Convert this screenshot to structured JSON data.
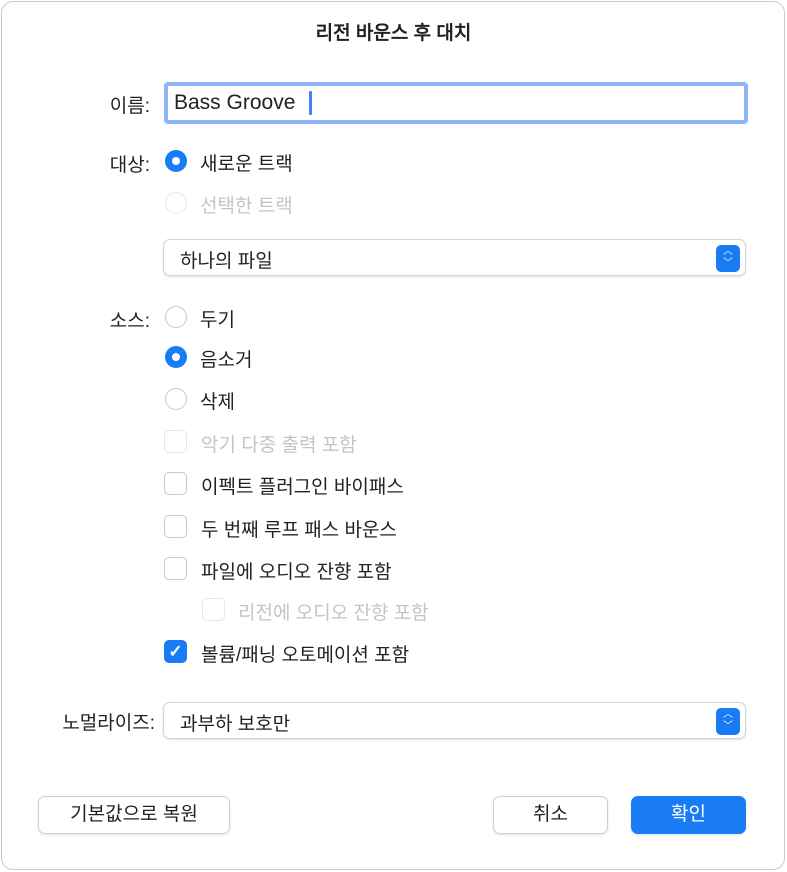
{
  "title": "리전 바운스 후 대치",
  "name": {
    "label": "이름:",
    "value": "Bass Groove"
  },
  "destination": {
    "label": "대상:",
    "options": [
      {
        "label": "새로운 트랙",
        "selected": true,
        "enabled": true
      },
      {
        "label": "선택한 트랙",
        "selected": false,
        "enabled": false
      }
    ],
    "file_mode": "하나의 파일"
  },
  "source": {
    "label": "소스:",
    "options": [
      {
        "label": "두기",
        "selected": false
      },
      {
        "label": "음소거",
        "selected": true
      },
      {
        "label": "삭제",
        "selected": false
      }
    ]
  },
  "checkboxes": [
    {
      "label": "악기 다중 출력 포함",
      "checked": false,
      "enabled": false
    },
    {
      "label": "이펙트 플러그인 바이패스",
      "checked": false,
      "enabled": true
    },
    {
      "label": "두 번째 루프 패스 바운스",
      "checked": false,
      "enabled": true
    },
    {
      "label": "파일에 오디오 잔향 포함",
      "checked": false,
      "enabled": true
    },
    {
      "label": "리전에 오디오 잔향 포함",
      "checked": false,
      "enabled": false
    },
    {
      "label": "볼륨/패닝 오토메이션 포함",
      "checked": true,
      "enabled": true
    }
  ],
  "normalize": {
    "label": "노멀라이즈:",
    "value": "과부하 보호만"
  },
  "buttons": {
    "restore": "기본값으로 복원",
    "cancel": "취소",
    "ok": "확인"
  }
}
